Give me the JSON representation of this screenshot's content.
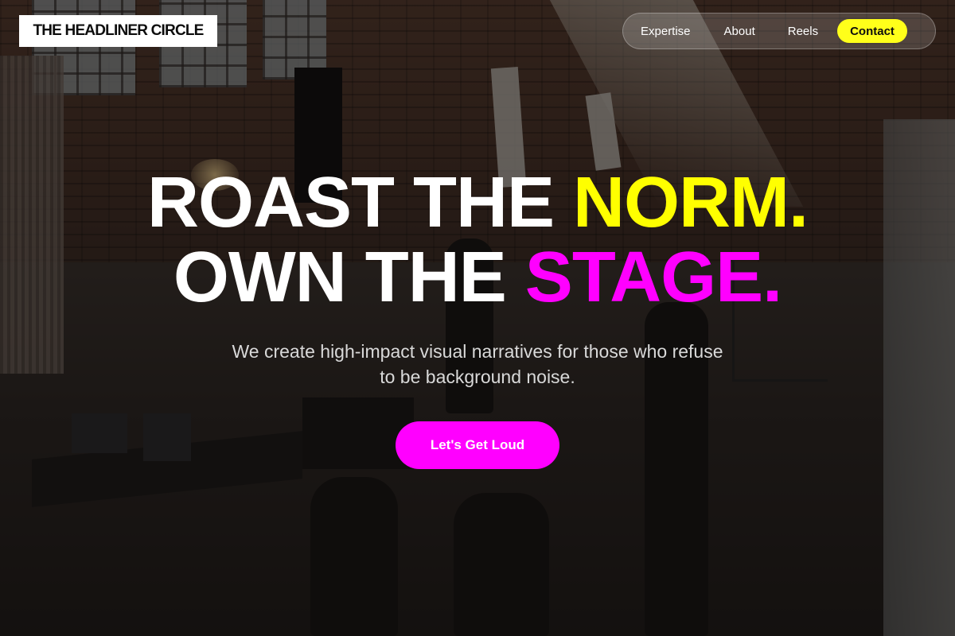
{
  "brand": {
    "logo_text": "THE HEADLINER CIRCLE"
  },
  "nav": {
    "items": [
      {
        "label": "Expertise"
      },
      {
        "label": "About"
      },
      {
        "label": "Reels"
      }
    ],
    "cta_label": "Contact"
  },
  "hero": {
    "line1_white": "ROAST THE ",
    "line1_accent": "NORM.",
    "line2_white": "OWN THE ",
    "line2_accent": "STAGE.",
    "subtitle": "We create high-impact visual narratives for those who refuse to be background noise.",
    "cta_label": "Let's Get Loud"
  },
  "colors": {
    "accent_yellow": "#ffff00",
    "accent_magenta": "#ff00ff",
    "logo_background": "#ffffff",
    "background_overlay": "#0a0808"
  },
  "background": {
    "description": "film-set-warehouse-photo"
  }
}
